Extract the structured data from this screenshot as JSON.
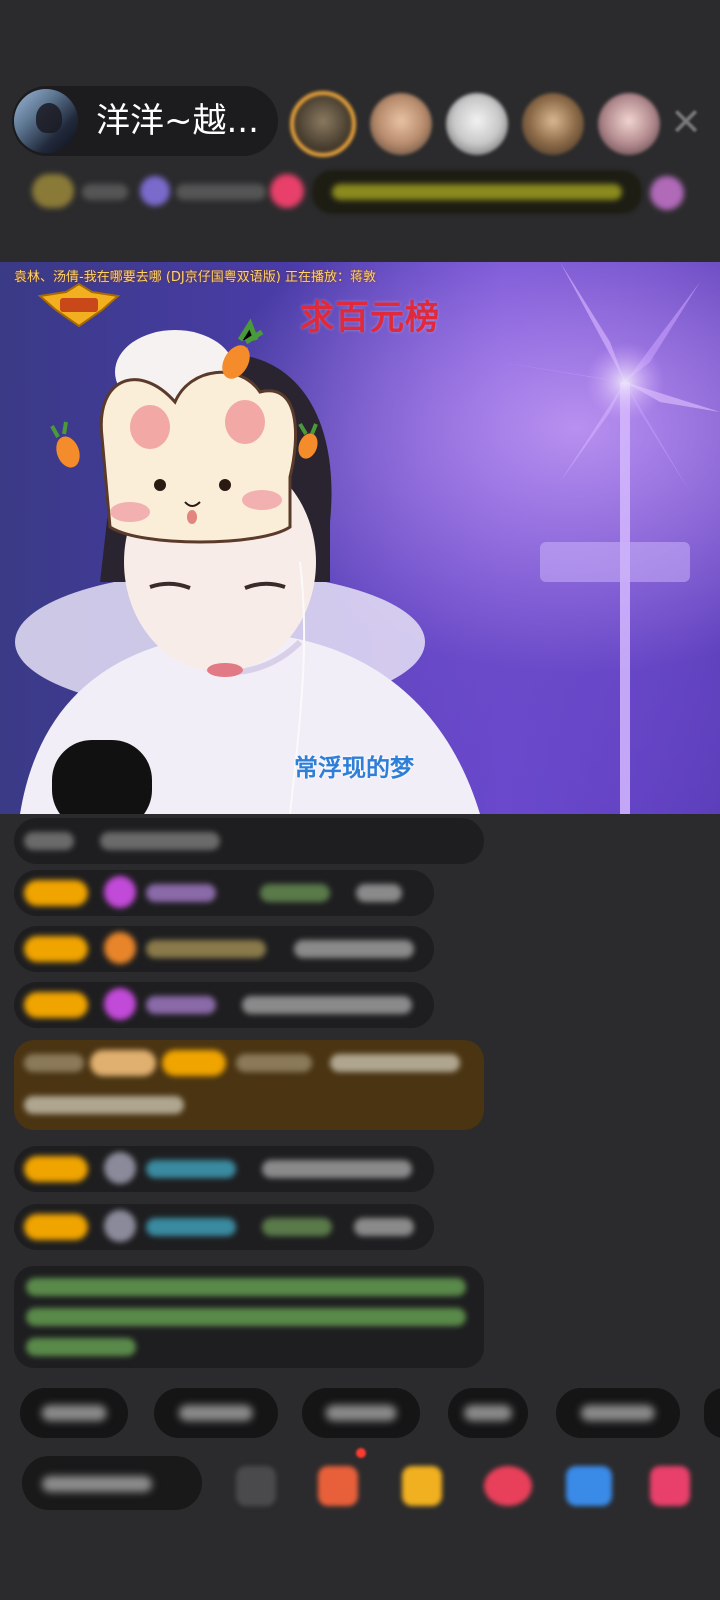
{
  "header": {
    "host_name": "洋洋~越...",
    "viewer_avatar_count": 5
  },
  "video": {
    "ticker_text": "袁林、汤倩-我在哪要去哪 (DJ京仔国粤双语版) 正在播放：蒋敦",
    "promo_text": "求百元榜",
    "lyric_text": "常浮现的梦"
  },
  "colors": {
    "background": "#2b2b2d",
    "chip_background": "#1c1c1e",
    "level_badge": "#f0a400",
    "promo_red": "#e0293a",
    "lyric_blue": "#2f7fd8",
    "highlight_message_bg": "#4a3412"
  },
  "icons": {
    "close": "close-icon",
    "emoji": "emoji-icon",
    "gift_box": "gift-box-icon",
    "fries": "fries-gift-icon",
    "heart_gift": "heart-gift-icon",
    "game": "game-controller-icon",
    "more_gifts": "gift-icon"
  }
}
